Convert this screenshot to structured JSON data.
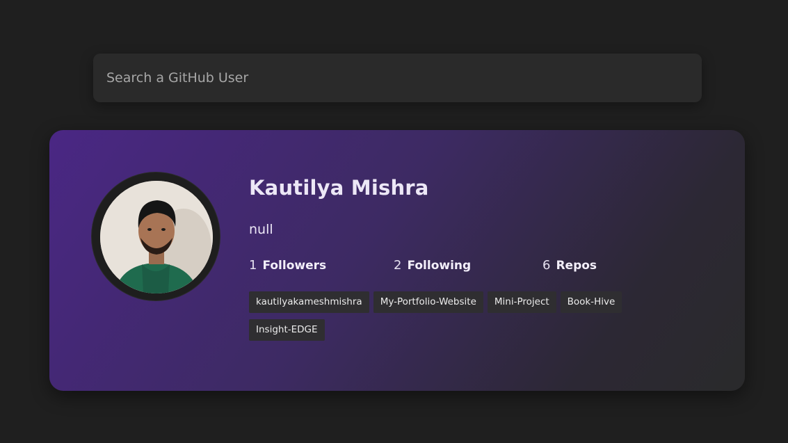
{
  "search": {
    "placeholder": "Search a GitHub User",
    "value": ""
  },
  "profile": {
    "name": "Kautilya Mishra",
    "bio": "null",
    "avatar_icon": "user-avatar-photo",
    "stats": {
      "followers": {
        "count": "1",
        "label": "Followers"
      },
      "following": {
        "count": "2",
        "label": "Following"
      },
      "repos": {
        "count": "6",
        "label": "Repos"
      }
    },
    "repos": [
      "kautilyakameshmishra",
      "My-Portfolio-Website",
      "Mini-Project",
      "Book-Hive",
      "Insight-EDGE"
    ]
  },
  "colors": {
    "page_bg": "#1f1f1f",
    "card_gradient_start": "#4a2784",
    "card_gradient_end": "#2a2a2b",
    "repo_chip_bg": "#2f2e31"
  }
}
